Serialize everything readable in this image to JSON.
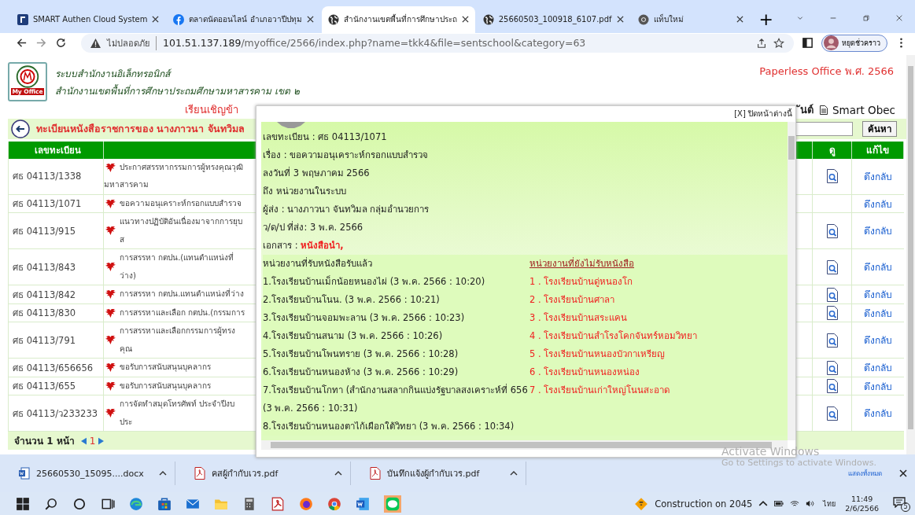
{
  "browser": {
    "tabs": [
      {
        "title": "SMART Authen Cloud System",
        "selected": false
      },
      {
        "title": "ตลาดนัดออนไลน์ อำเภอวาปีปทุม",
        "selected": false
      },
      {
        "title": "สำนักงานเขตพื้นที่การศึกษาประถ",
        "selected": true
      },
      {
        "title": "25660503_100918_6107.pdf",
        "selected": false
      },
      {
        "title": "แท็บใหม่",
        "selected": false
      }
    ],
    "new_tab": "+",
    "security": "ไม่ปลอดภัย",
    "url_host": "101.51.137.189",
    "url_path": "/myoffice/2566/index.php?name=tkk4&file=sentschool&category=63",
    "profile": "หยุดชั่วคราว"
  },
  "site": {
    "logo_text": "My Office",
    "title": "ระบบสำนักงานอิเล็กทรอนิกส์",
    "subtitle": "สำนักงานเขตพื้นที่การศึกษาประถมศึกษามหาสารคาม เขต ๒",
    "brand": "Paperless Office พ.ศ. 2566",
    "invite": "เรียนเชิญข้า",
    "menu_tail": "ันต์",
    "smart_obec": "Smart Obec"
  },
  "register": {
    "heading": "ทะเบียนหนังสือราชการของ นางภาวนา จันทวิมล",
    "search_button": "ค้นหา",
    "columns": [
      "เลขทะเบียน",
      "ดู",
      "แก้ไข"
    ],
    "rows": [
      {
        "number": "ศธ 04113/1338",
        "subject": "ประกาศสรรหากรรมการผู้ทรงคุณวุฒิ",
        "subject_line2": "มหาสารคาม",
        "viewable": true,
        "action": "ดึงกลับ"
      },
      {
        "number": "ศธ 04113/1071",
        "subject": "ขอความอนุเคราะห์กรอกแบบสำรวจ",
        "viewable": false,
        "action": "ดึงกลับ"
      },
      {
        "number": "ศธ 04113/915",
        "subject": "แนวทางปฏิบัติอันเนื่องมาจากการยุบส",
        "viewable": true,
        "action": "ดึงกลับ"
      },
      {
        "number": "ศธ 04113/843",
        "subject": "การสรรหา กตปน.(แทนตำแหน่งที่ว่าง)",
        "viewable": true,
        "action": "ดึงกลับ"
      },
      {
        "number": "ศธ 04113/842",
        "subject": "การสรรหา กตปน.แทนตำแหน่งที่ว่าง",
        "viewable": true,
        "action": "ดึงกลับ"
      },
      {
        "number": "ศธ 04113/830",
        "subject": "การสรรหาและเลือก กตปน.(กรรมการ",
        "viewable": true,
        "action": "ดึงกลับ"
      },
      {
        "number": "ศธ 04113/791",
        "subject": "การสรรหาและเลือกกรรมการผู้ทรงคุณ",
        "viewable": true,
        "action": "ดึงกลับ"
      },
      {
        "number": "ศธ 04113/656656",
        "subject": "ขอรับการสนับสนุนบุคลากร",
        "viewable": true,
        "action": "ดึงกลับ"
      },
      {
        "number": "ศธ 04113/655",
        "subject": "ขอรับการสนับสนุนบุคลากร",
        "viewable": true,
        "action": "ดึงกลับ"
      },
      {
        "number": "ศธ 04113/ว233233",
        "subject": "การจัดทำสมุดโทรศัพท์ ประจำปีงบประ",
        "viewable": true,
        "action": "ดึงกลับ"
      }
    ],
    "pager_label": "จำนวน 1 หน้า",
    "pages": [
      {
        "label": "1",
        "selected": true
      }
    ]
  },
  "popup": {
    "close": "[X] ปิดหน้าต่างนี้",
    "details": [
      "เลขทะเบียน : ศธ 04113/1071",
      "เรื่อง : ขอความอนุเคราะห์กรอกแบบสำรวจ",
      "ลงวันที่ 3 พฤษภาคม 2566",
      "ถึง หน่วยงานในระบบ",
      "ผู้ส่ง : นางภาวนา จันทวิมล กลุ่มอำนวยการ",
      "ว/ด/ป ที่ส่ง: 3 พ.ค. 2566"
    ],
    "attachment_label": "เอกสาร : ",
    "attachment": "หนังสือนำ,",
    "received_heading": "หน่วยงานที่รับหนังสือรับแล้ว",
    "received": [
      "1.โรงเรียนบ้านเม็กน้อยหนองไผ่ (3 พ.ค. 2566 : 10:20)",
      "2.โรงเรียนบ้านโนน. (3 พ.ค. 2566 : 10:21)",
      "3.โรงเรียนบ้านจอมพะลาน (3 พ.ค. 2566 : 10:23)",
      "4.โรงเรียนบ้านสนาม (3 พ.ค. 2566 : 10:26)",
      "5.โรงเรียนบ้านโพนทราย (3 พ.ค. 2566 : 10:28)",
      "6.โรงเรียนบ้านหนองห้าง (3 พ.ค. 2566 : 10:29)",
      "7.โรงเรียนบ้านโกทา (สำนักงานสลากกินแบ่งรัฐบาลสงเคราะห์ที่ 656 (3 พ.ค. 2566 : 10:31)",
      "8.โรงเรียนบ้านหนองตาไก้เผือกใต้วิทยา (3 พ.ค. 2566 : 10:34)"
    ],
    "pending_heading": "หน่วยงานที่ยังไม่รับหนังสือ",
    "pending": [
      "1 . โรงเรียนบ้านดู่หนองโก",
      "2 . โรงเรียนบ้านศาลา",
      "3 . โรงเรียนบ้านสระแคน",
      "4 . โรงเรียนบ้านสำโรงโคกจันทร์หอมวิทยา",
      "5 . โรงเรียนบ้านหนองบัวกาเหรียญ",
      "6 . โรงเรียนบ้านหนองหน่อง",
      "7 . โรงเรียนบ้านเก่าใหญ่โนนสะอาด"
    ]
  },
  "activation": {
    "title": "Activate Windows",
    "hint": "Go to Settings to activate Windows."
  },
  "downloads": {
    "items": [
      {
        "name": "25660530_15095....docx",
        "kind": "word"
      },
      {
        "name": "คสผู้กำกับเวร.pdf",
        "kind": "pdf"
      },
      {
        "name": "บันทึกแจ้งผู้กำกับเวร.pdf",
        "kind": "pdf"
      }
    ],
    "show_all": "แสดงทั้งหมด"
  },
  "taskbar": {
    "weather": "Construction on 2045",
    "language": "ไทย",
    "time": "11:49",
    "date": "2/6/2566",
    "notifications": "5"
  }
}
